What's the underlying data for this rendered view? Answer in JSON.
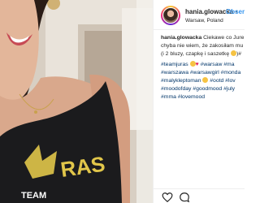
{
  "post": {
    "username": "hania.glowacka",
    "separator": "•",
    "follow_label": "Obser",
    "location": "Warsaw, Poland"
  },
  "caption": {
    "user": "hania.glowacka",
    "line1": "Ciekawe co Jure",
    "line2": "chyba nie wiem, że zakosiłam mu i",
    "line3a": "(i 2 bluzy, czapkę i saszetkę",
    "line3b": ")#"
  },
  "hashtags": {
    "line1a": "#teamjuras",
    "line1b": "#warsaw #ma",
    "line2": "#warszawa #warsawgirl #monda",
    "line3a": "#malykleptoman",
    "line3b": "#ootd #lov",
    "line4": "#moodofday #goodmood #july",
    "line5": "#mma #lovemood"
  },
  "colors": {
    "link": "#3897f0",
    "hashtag": "#003569",
    "text": "#262626",
    "divider": "#efefef"
  },
  "icons": [
    "heart-icon",
    "comment-icon",
    "avatar-photo",
    "emoji-heart-eyes",
    "emoji-heart",
    "emoji-grin"
  ]
}
